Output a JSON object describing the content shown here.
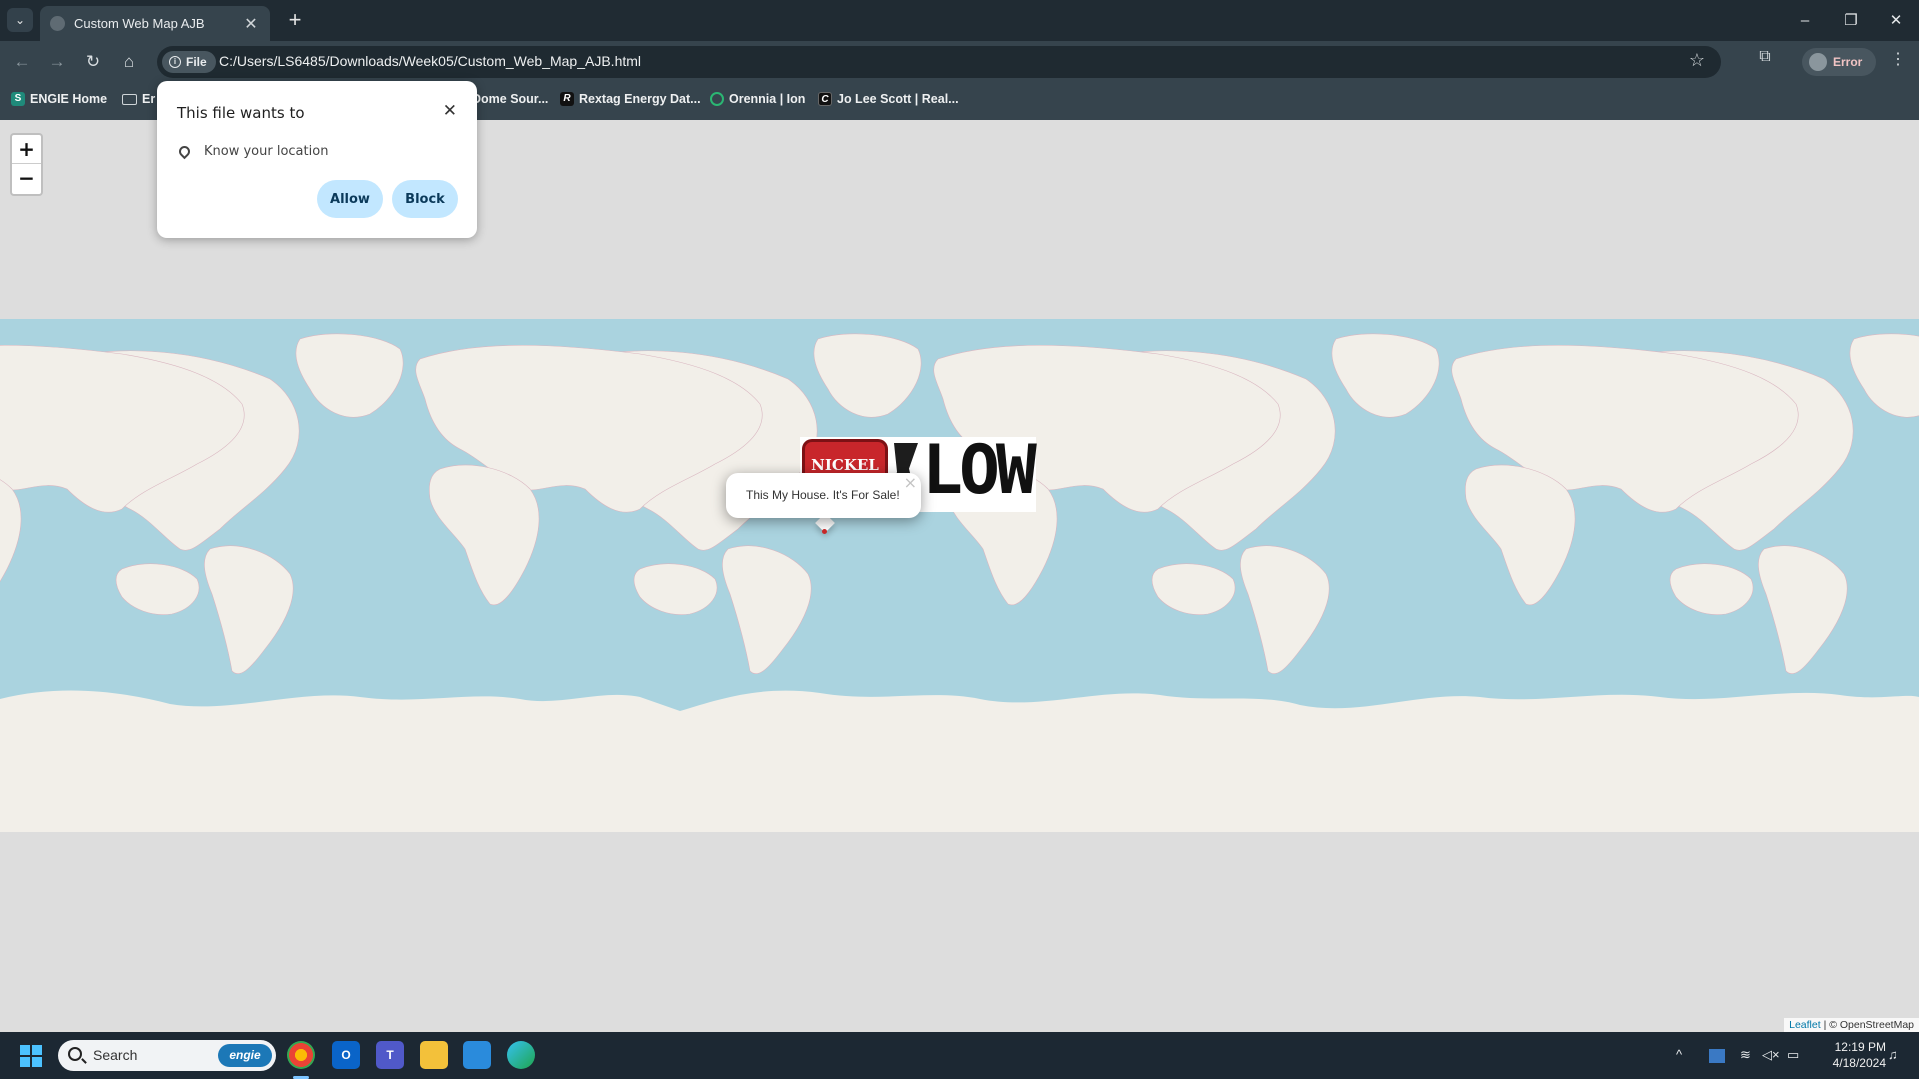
{
  "browser": {
    "tab": {
      "title": "Custom Web Map AJB",
      "close_glyph": "✕"
    },
    "new_tab_glyph": "+",
    "window_controls": {
      "minimize": "–",
      "restore": "❐",
      "close": "✕"
    },
    "toolbar": {
      "back_glyph": "←",
      "forward_glyph": "→",
      "reload_glyph": "↻",
      "home_glyph": "⌂",
      "file_chip_label": "File",
      "url": "C:/Users/LS6485/Downloads/Week05/Custom_Web_Map_AJB.html",
      "bookmark_star_glyph": "☆",
      "profile_label": "Error"
    },
    "bookmarks": [
      {
        "label": "ENGIE Home",
        "icon": "engie-icon"
      },
      {
        "label": "Er",
        "icon": "folder-icon"
      },
      {
        "label": "Dome Sour...",
        "icon": "generic-icon"
      },
      {
        "label": "Rextag Energy Dat...",
        "icon": "rextag-icon"
      },
      {
        "label": "Orennia | Ion",
        "icon": "orennia-icon"
      },
      {
        "label": "Jo Lee Scott | Real...",
        "icon": "jo-lee-scott-icon"
      }
    ]
  },
  "permission_prompt": {
    "title": "This file wants to",
    "close_glyph": "✕",
    "permission": "Know your location",
    "allow_label": "Allow",
    "block_label": "Block"
  },
  "map": {
    "zoom_in_label": "+",
    "zoom_out_label": "−",
    "popup_text": "This My House. It's For Sale!",
    "popup_close_glyph": "×",
    "marker_image_text": {
      "badge": "NICKEL",
      "wordmark": "LOW"
    },
    "attribution": {
      "leaflet": "Leaflet",
      "separator": " | ",
      "osm": "© OpenStreetMap"
    },
    "colors": {
      "ocean": "#aad3df",
      "land": "#f2efe9",
      "background": "#dddddd"
    }
  },
  "taskbar": {
    "search_placeholder": "Search",
    "search_badge": "engie",
    "apps": [
      "chrome-icon",
      "outlook-icon",
      "teams-icon",
      "file-explorer-icon",
      "store-icon",
      "edge-icon"
    ],
    "clock": {
      "time": "12:19 PM",
      "date": "4/18/2024"
    }
  }
}
